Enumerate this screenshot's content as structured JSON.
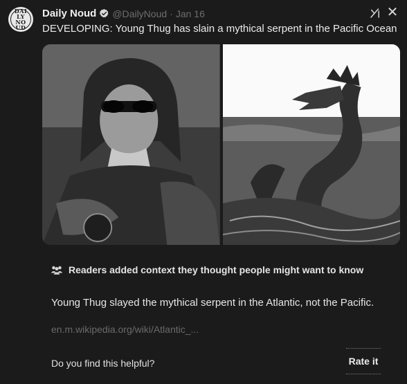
{
  "author": {
    "name": "Daily Noud",
    "handle": "@DailyNoud",
    "separator": "·",
    "date": "Jan 16",
    "avatar_text": "DAILY NOUD"
  },
  "icons": {
    "verified": "verified-badge-icon",
    "grok": "grok-icon",
    "close": "close-icon",
    "people": "people-icon"
  },
  "tweet": {
    "text": "DEVELOPING: Young Thug has slain a mythical serpent in the Pacific Ocean"
  },
  "media": [
    {
      "subject": "rapper-in-sunglasses"
    },
    {
      "subject": "sea-serpent"
    }
  ],
  "note": {
    "title": "Readers added context they thought people might want to know",
    "body": "Young Thug slayed the mythical serpent in the Atlantic, not the Pacific.",
    "link": "en.m.wikipedia.org/wiki/Atlantic_...",
    "helpful_prompt": "Do you find this helpful?",
    "rate_label": "Rate it"
  },
  "colors": {
    "background": "#1b1b1b",
    "text": "#e7e7e7",
    "muted": "#6e6e6e"
  }
}
